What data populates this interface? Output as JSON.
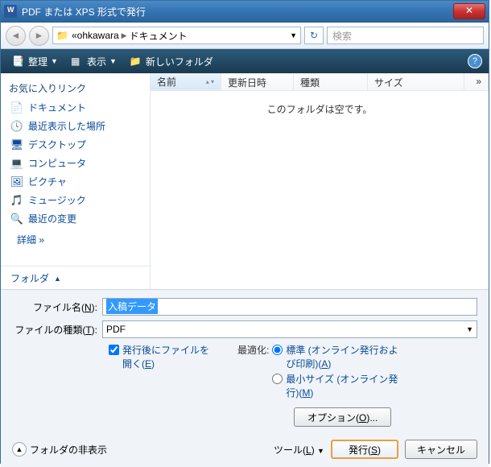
{
  "title": "PDF または XPS 形式で発行",
  "breadcrumb": {
    "part1": "ohkawara",
    "part2": "ドキュメント"
  },
  "search_placeholder": "検索",
  "toolbar": {
    "organize": "整理",
    "view": "表示",
    "new_folder": "新しいフォルダ"
  },
  "sidebar": {
    "title": "お気に入りリンク",
    "items": [
      {
        "icon": "📄",
        "label": "ドキュメント"
      },
      {
        "icon": "🕓",
        "label": "最近表示した場所"
      },
      {
        "icon": "🖥",
        "label": "デスクトップ"
      },
      {
        "icon": "💻",
        "label": "コンピュータ"
      },
      {
        "icon": "🖼",
        "label": "ピクチャ"
      },
      {
        "icon": "🎵",
        "label": "ミュージック"
      },
      {
        "icon": "🔍",
        "label": "最近の変更"
      }
    ],
    "detail": "詳細 »",
    "folder": "フォルダ"
  },
  "columns": {
    "name": "名前",
    "date": "更新日時",
    "type": "種類",
    "size": "サイズ",
    "more": "»"
  },
  "empty": "このフォルダは空です。",
  "form": {
    "filename_label": "ファイル名(N):",
    "filename_value": "入稿データ",
    "filetype_label": "ファイルの種類(T):",
    "filetype_value": "PDF",
    "open_after": "発行後にファイルを開く(E)",
    "optimize_label": "最適化:",
    "opt_standard": "標準 (オンライン発行および印刷)(A)",
    "opt_minimum": "最小サイズ (オンライン発行)(M)",
    "options_btn": "オプション(O)...",
    "hide_folder": "フォルダの非表示",
    "tools": "ツール(L)",
    "publish": "発行(S)",
    "cancel": "キャンセル"
  }
}
